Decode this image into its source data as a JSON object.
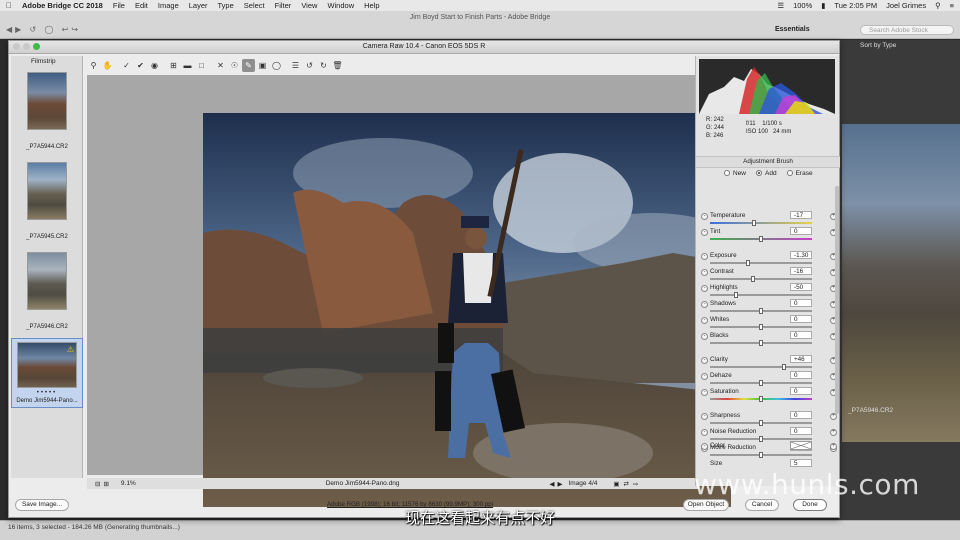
{
  "menubar": {
    "app_name": "Adobe Bridge CC 2018",
    "items": [
      "File",
      "Edit",
      "Image",
      "Layer",
      "Type",
      "Select",
      "Filter",
      "View",
      "Window",
      "Help"
    ],
    "battery": "100%",
    "clock": "Tue 2:05 PM",
    "user": "Joel Grimes"
  },
  "bridge": {
    "window_title": "Jim Boyd Start to Finish Parts - Adobe Bridge",
    "workspace": "Essentials",
    "search_placeholder": "Search Adobe Stock",
    "sort_label": "Sort by Type",
    "right_thumb_label": "_P7A5946.CR2",
    "status_text": "16 items, 3 selected - 184.26 MB (Generating thumbnails...)"
  },
  "camera_raw": {
    "title": "Camera Raw 10.4  -  Canon EOS 5DS R",
    "filmstrip_title": "Filmstrip",
    "filmstrip": [
      {
        "label": "_P7A5944.CR2",
        "thumb": "t1"
      },
      {
        "label": "_P7A5945.CR2",
        "thumb": "t2"
      },
      {
        "label": "_P7A5946.CR2",
        "thumb": "t3"
      },
      {
        "label": "Demo Jim5944-Pano...",
        "thumb": "t4",
        "selected": true
      }
    ],
    "zoom": "9.1%",
    "file_name": "Demo Jim5944-Pano.dng",
    "image_counter": "Image 4/4",
    "workflow_link": "Adobe RGB (1998); 16 bit; 11576 by 8630 (99.9MP); 300 ppi",
    "buttons": {
      "save_image": "Save Image...",
      "open_object": "Open Object",
      "cancel": "Cancel",
      "done": "Done"
    },
    "readout": {
      "r": "R:  242",
      "g": "G:  244",
      "b": "B:  246",
      "aperture": "f/11",
      "shutter": "1/100 s",
      "iso": "ISO 100",
      "focal": "24 mm"
    },
    "panel_title": "Adjustment Brush",
    "modes": [
      "New",
      "Add",
      "Erase"
    ],
    "active_mode": "Add",
    "sliders": [
      {
        "label": "Temperature",
        "value": "-17",
        "pos": 0.43
      },
      {
        "label": "Tint",
        "value": "0",
        "pos": 0.5
      },
      {
        "label": "Exposure",
        "value": "-1.30",
        "pos": 0.37
      },
      {
        "label": "Contrast",
        "value": "-16",
        "pos": 0.42
      },
      {
        "label": "Highlights",
        "value": "-50",
        "pos": 0.25
      },
      {
        "label": "Shadows",
        "value": "0",
        "pos": 0.5
      },
      {
        "label": "Whites",
        "value": "0",
        "pos": 0.5
      },
      {
        "label": "Blacks",
        "value": "0",
        "pos": 0.5
      },
      {
        "label": "Clarity",
        "value": "+46",
        "pos": 0.73
      },
      {
        "label": "Dehaze",
        "value": "0",
        "pos": 0.5
      },
      {
        "label": "Saturation",
        "value": "0",
        "pos": 0.5
      },
      {
        "label": "Sharpness",
        "value": "0",
        "pos": 0.5
      },
      {
        "label": "Noise Reduction",
        "value": "0",
        "pos": 0.5
      },
      {
        "label": "Moire Reduction",
        "value": "0",
        "pos": 0.5
      },
      {
        "label": "Defringe",
        "value": "0",
        "pos": 0.5
      }
    ],
    "color_label": "Color",
    "size_label": "Size",
    "size_value": "5"
  },
  "overlay": {
    "subtitle": "现在这看起来有点不好",
    "watermark": "www.hunls.com"
  }
}
